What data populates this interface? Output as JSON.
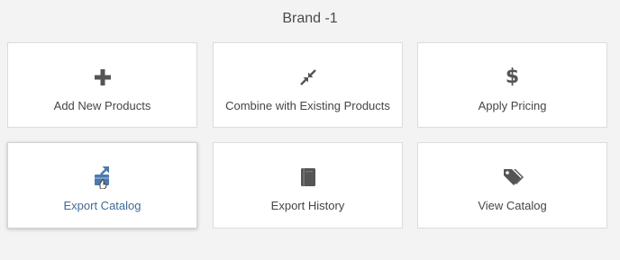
{
  "page": {
    "title": "Brand -1"
  },
  "cards": [
    {
      "label": "Add New Products",
      "icon": "plus-icon"
    },
    {
      "label": "Combine with Existing Products",
      "icon": "compress-arrows-icon"
    },
    {
      "label": "Apply Pricing",
      "icon": "dollar-icon"
    },
    {
      "label": "Export Catalog",
      "icon": "export-catalog-icon",
      "active": true
    },
    {
      "label": "Export History",
      "icon": "book-icon"
    },
    {
      "label": "View Catalog",
      "icon": "tags-icon"
    }
  ],
  "colors": {
    "background": "#f3f3f3",
    "card": "#ffffff",
    "icon": "#555555",
    "active_blue": "#3f6a97",
    "active_icon": "#4d79ad"
  }
}
